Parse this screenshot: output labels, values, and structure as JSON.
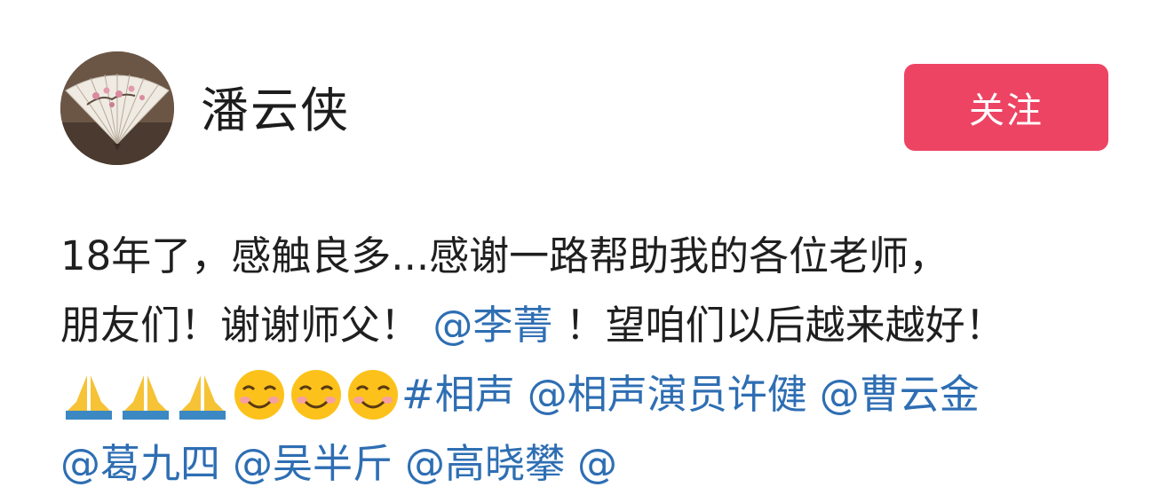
{
  "author": {
    "name": "潘云侠",
    "avatar": "folding-fan-avatar"
  },
  "follow_button": {
    "label": "关注",
    "color": "#ee4464"
  },
  "post": {
    "line1": "18年了，感触良多...感谢一路帮助我的各位老师，",
    "line2_text": "朋友们！谢谢师父！",
    "line2_mention": "@李菁",
    "line2_tail": "！望咱们以后越来越好！",
    "emojis": [
      "folded-hands",
      "folded-hands",
      "folded-hands",
      "smiling-face",
      "smiling-face",
      "smiling-face"
    ],
    "line3_hashtag": "#相声",
    "line3_mentions": [
      "@相声演员许健",
      "@曹云金"
    ],
    "line4_mentions": [
      "@葛九四",
      "@吴半斤",
      "@高晓攀",
      "@"
    ],
    "link_color": "#2e6eb3"
  }
}
